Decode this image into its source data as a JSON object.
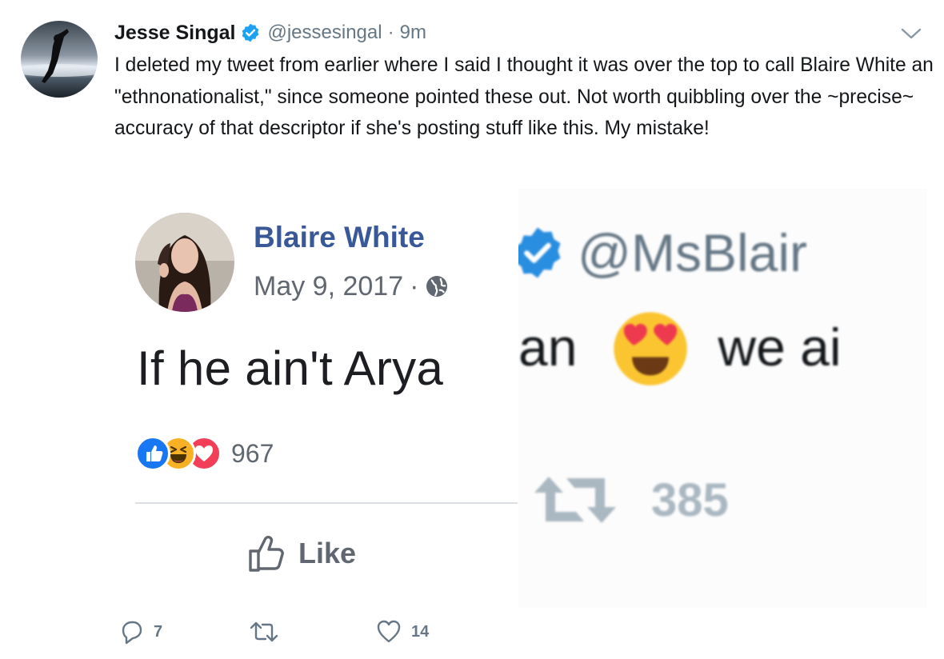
{
  "tweet": {
    "author_name": "Jesse Singal",
    "handle": "@jessesingal",
    "separator": "·",
    "time": "9m",
    "text": "I deleted my tweet from earlier where I said I thought it was over the top to call Blaire White an \"ethnonationalist,\" since someone pointed these out. Not worth quibbling over the ~precise~ accuracy of that descriptor if she's posting stuff like this. My mistake!",
    "icons": {
      "verified": "verified-badge-icon",
      "caret": "chevron-down-icon"
    },
    "actions": {
      "reply_count": "7",
      "retweet_count": "",
      "like_count": "14"
    },
    "colors": {
      "verified_blue": "#1da1f2",
      "secondary_text": "#657786"
    }
  },
  "embedded_facebook_post": {
    "author_name": "Blaire White",
    "date": "May 9, 2017",
    "separator": "·",
    "text": "If he ain't Arya",
    "reaction_count": "967",
    "like_label": "Like",
    "colors": {
      "name_blue": "#385898",
      "like_blue": "#1877f2",
      "love_red": "#f33e58",
      "haha_yellow": "#f7b125"
    }
  },
  "embedded_tweet_crop": {
    "handle_fragment": "@MsBlair",
    "text_fragment_a": "an",
    "text_fragment_b": "we ai",
    "retweet_count": "385",
    "emoji": "heart-eyes-emoji"
  }
}
